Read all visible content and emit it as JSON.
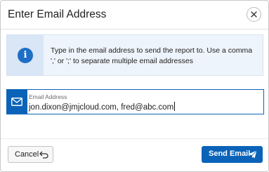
{
  "dialog": {
    "title": "Enter Email Address",
    "close_icon": "close-icon"
  },
  "info": {
    "icon": "info-icon",
    "icon_glyph": "i",
    "message": "Type in the email address to send the report to. Use a comma ',' or ';' to separate multiple email addresses"
  },
  "email_field": {
    "icon": "envelope-icon",
    "label": "Email Address",
    "value": "jon.dixon@jmjcloud.com, fred@abc.com"
  },
  "footer": {
    "cancel_label": "Cancel",
    "cancel_icon": "undo-icon",
    "send_label": "Send Email",
    "send_icon": "paper-plane-icon"
  },
  "colors": {
    "accent": "#0a63b8",
    "info_bg": "#eef4fb",
    "info_icon_bg": "#d8e6f6"
  }
}
